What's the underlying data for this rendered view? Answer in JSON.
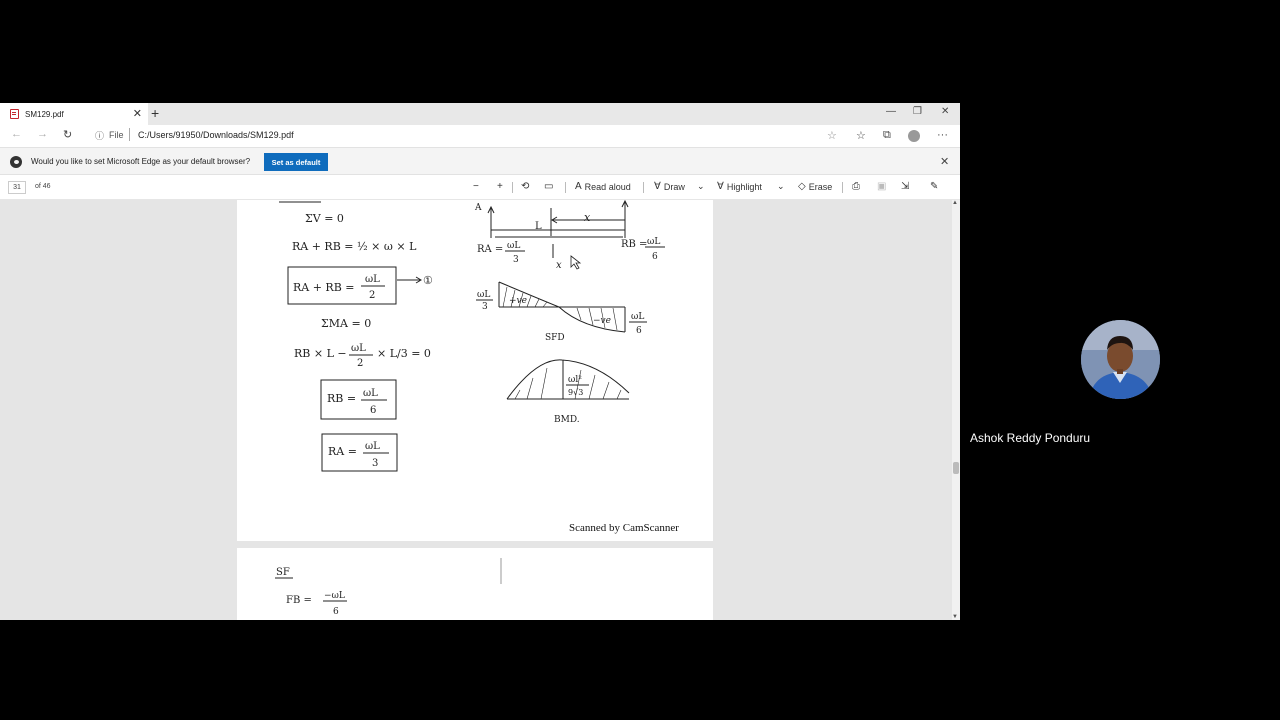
{
  "browser": {
    "tab_title": "SM129.pdf",
    "new_tab": "+",
    "url": "C:/Users/91950/Downloads/SM129.pdf",
    "file_label": "File",
    "infobar_text": "Would you like to set Microsoft Edge as your default browser?",
    "set_default_label": "Set as default"
  },
  "pdf_toolbar": {
    "page_number": "31",
    "page_count": "of 46",
    "read_aloud": "Read aloud",
    "draw": "Draw",
    "highlight": "Highlight",
    "erase": "Erase"
  },
  "document": {
    "page1": {
      "sum_v": "ΣV = 0",
      "ra_rb_eq": "RA + RB = ½ × ω × L",
      "boxed_ra_rb_lhs": "RA + RB =",
      "boxed_ra_rb_num": "ωL",
      "boxed_ra_rb_den": "2",
      "eq_ref": "①",
      "sum_ma": "ΣMA = 0",
      "moment_eq_lhs": "RB × L −",
      "moment_eq_num": "ωL",
      "moment_eq_den": "2",
      "moment_eq_rhs": "× L/3  =  0",
      "rb_lhs": "RB =",
      "rb_num": "ωL",
      "rb_den": "6",
      "ra_lhs": "RA =",
      "ra_num": "ωL",
      "ra_den": "3",
      "beam_a": "A",
      "beam_l": "L",
      "beam_x": "x",
      "beam_x2": "x",
      "beam_ra": "RA =",
      "beam_ra_num": "ωL",
      "beam_ra_den": "3",
      "beam_rb": "RB =",
      "beam_rb_num": "ωL",
      "beam_rb_den": "6",
      "sfd_left_num": "ωL",
      "sfd_left_den": "3",
      "sfd_pos": "+ve",
      "sfd_neg": "−ve",
      "sfd_right_num": "ωL",
      "sfd_right_den": "6",
      "sfd_label": "SFD",
      "bmd_num": "ωl²",
      "bmd_den": "9√3",
      "bmd_label": "BMD.",
      "scanned_by": "Scanned by CamScanner"
    },
    "page2": {
      "sf_heading": "SF",
      "fb_lhs": "FB =",
      "fb_num": "−ωL",
      "fb_den": "6"
    }
  },
  "participant": {
    "name": "Ashok Reddy Ponduru"
  }
}
